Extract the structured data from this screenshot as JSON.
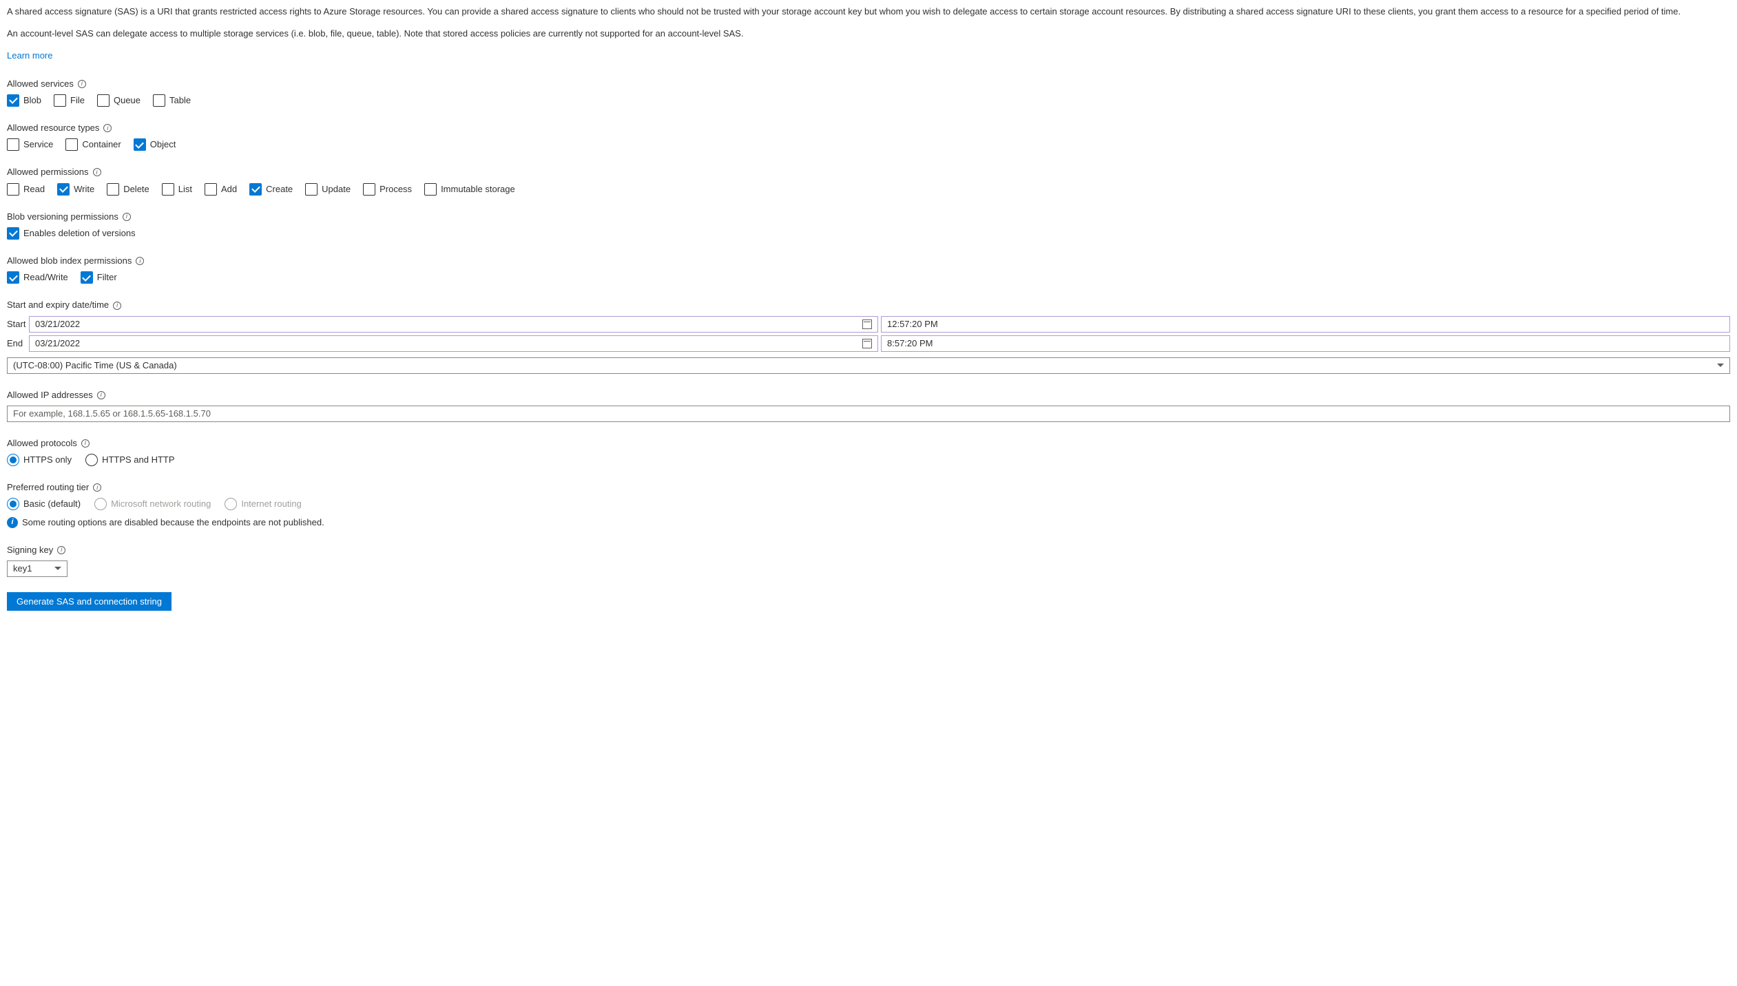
{
  "intro": {
    "p1": "A shared access signature (SAS) is a URI that grants restricted access rights to Azure Storage resources. You can provide a shared access signature to clients who should not be trusted with your storage account key but whom you wish to delegate access to certain storage account resources. By distributing a shared access signature URI to these clients, you grant them access to a resource for a specified period of time.",
    "p2": "An account-level SAS can delegate access to multiple storage services (i.e. blob, file, queue, table). Note that stored access policies are currently not supported for an account-level SAS.",
    "learn_more": "Learn more"
  },
  "services": {
    "label": "Allowed services",
    "items": [
      {
        "label": "Blob",
        "checked": true
      },
      {
        "label": "File",
        "checked": false
      },
      {
        "label": "Queue",
        "checked": false
      },
      {
        "label": "Table",
        "checked": false
      }
    ]
  },
  "resource_types": {
    "label": "Allowed resource types",
    "items": [
      {
        "label": "Service",
        "checked": false
      },
      {
        "label": "Container",
        "checked": false
      },
      {
        "label": "Object",
        "checked": true
      }
    ]
  },
  "permissions": {
    "label": "Allowed permissions",
    "items": [
      {
        "label": "Read",
        "checked": false
      },
      {
        "label": "Write",
        "checked": true
      },
      {
        "label": "Delete",
        "checked": false
      },
      {
        "label": "List",
        "checked": false
      },
      {
        "label": "Add",
        "checked": false
      },
      {
        "label": "Create",
        "checked": true
      },
      {
        "label": "Update",
        "checked": false
      },
      {
        "label": "Process",
        "checked": false
      },
      {
        "label": "Immutable storage",
        "checked": false
      }
    ]
  },
  "blob_versioning": {
    "label": "Blob versioning permissions",
    "items": [
      {
        "label": "Enables deletion of versions",
        "checked": true
      }
    ]
  },
  "blob_index": {
    "label": "Allowed blob index permissions",
    "items": [
      {
        "label": "Read/Write",
        "checked": true
      },
      {
        "label": "Filter",
        "checked": true
      }
    ]
  },
  "datetime": {
    "label": "Start and expiry date/time",
    "start_label": "Start",
    "end_label": "End",
    "start_date": "03/21/2022",
    "start_time": "12:57:20 PM",
    "end_date": "03/21/2022",
    "end_time": "8:57:20 PM",
    "timezone": "(UTC-08:00) Pacific Time (US & Canada)"
  },
  "ip": {
    "label": "Allowed IP addresses",
    "placeholder": "For example, 168.1.5.65 or 168.1.5.65-168.1.5.70"
  },
  "protocols": {
    "label": "Allowed protocols",
    "items": [
      {
        "label": "HTTPS only",
        "selected": true
      },
      {
        "label": "HTTPS and HTTP",
        "selected": false
      }
    ]
  },
  "routing": {
    "label": "Preferred routing tier",
    "items": [
      {
        "label": "Basic (default)",
        "selected": true,
        "disabled": false
      },
      {
        "label": "Microsoft network routing",
        "selected": false,
        "disabled": true
      },
      {
        "label": "Internet routing",
        "selected": false,
        "disabled": true
      }
    ],
    "note": "Some routing options are disabled because the endpoints are not published."
  },
  "signing_key": {
    "label": "Signing key",
    "value": "key1"
  },
  "button": {
    "generate": "Generate SAS and connection string"
  }
}
